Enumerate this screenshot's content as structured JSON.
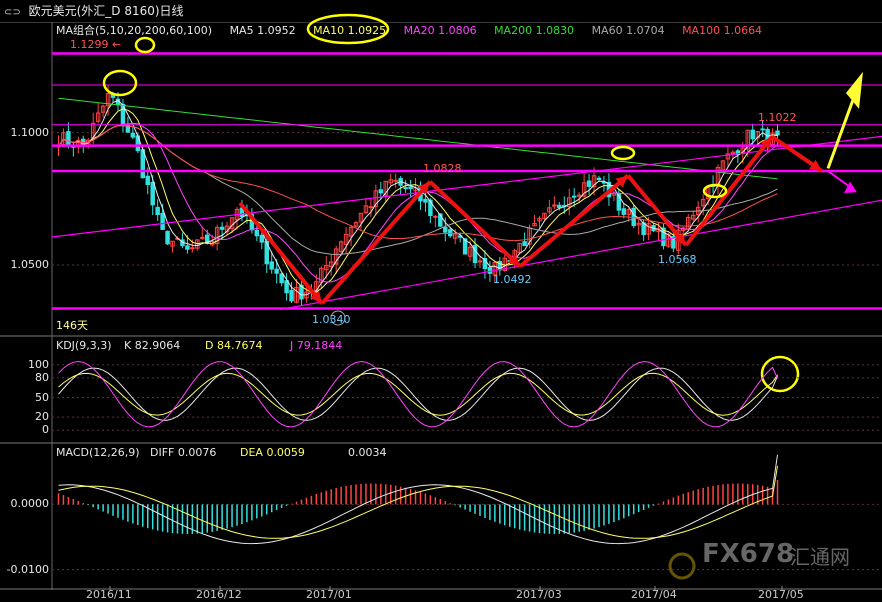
{
  "window": {
    "symbol_icon": "chart-toggle-icon",
    "title": "欧元美元(外汇_D 8160)日线"
  },
  "ma_header": {
    "group": "MA组合(5,10,20,200,60,100)",
    "ma5": "MA5 1.0952",
    "ma10": "MA10 1.0925",
    "ma20": "MA20 1.0806",
    "ma200": "MA200 1.0830",
    "ma60": "MA60 1.0704",
    "ma100": "MA100 1.0664"
  },
  "colors": {
    "ma5": "#e8e8e8",
    "ma10": "#ffff66",
    "ma20": "#ff44ff",
    "ma200": "#33dd33",
    "ma60": "#aaaaaa",
    "ma100": "#ff5050",
    "up": "#ff4444",
    "down": "#33e0e0",
    "trend": "#ff00ff",
    "arrow": "#ee1111",
    "highlight": "#ffff00"
  },
  "chart_data": [
    {
      "type": "candlestick",
      "title": "欧元美元(外汇_D 8160)日线",
      "x_labels": [
        "2016/11",
        "2016/12",
        "2017/01",
        "2017/03",
        "2017/04",
        "2017/05"
      ],
      "ytick_labels": [
        "1.1000",
        "1.0500"
      ],
      "ylim": [
        1.03,
        1.135
      ],
      "annotations": [
        {
          "label": "1.1299",
          "value": 1.1299
        },
        {
          "label": "1.0828",
          "value": 1.0828
        },
        {
          "label": "1.1022",
          "value": 1.1022
        },
        {
          "label": "1.0492",
          "value": 1.0492
        },
        {
          "label": "1.0568",
          "value": 1.0568
        },
        {
          "label": "1.0340",
          "value": 1.034
        }
      ],
      "period_label": "146天",
      "horizontal_levels": [
        1.1299,
        1.0951,
        1.0855,
        1.0336
      ],
      "price_path": [
        1.098,
        1.095,
        1.115,
        1.095,
        1.062,
        1.055,
        1.06,
        1.072,
        1.055,
        1.038,
        1.042,
        1.06,
        1.072,
        1.082,
        1.076,
        1.064,
        1.055,
        1.048,
        1.058,
        1.068,
        1.078,
        1.083,
        1.07,
        1.063,
        1.058,
        1.075,
        1.09,
        1.1,
        1.097
      ],
      "series": [
        {
          "name": "MA5",
          "value": 1.0952
        },
        {
          "name": "MA10",
          "value": 1.0925
        },
        {
          "name": "MA20",
          "value": 1.0806
        },
        {
          "name": "MA200",
          "value": 1.083
        },
        {
          "name": "MA60",
          "value": 1.0704
        },
        {
          "name": "MA100",
          "value": 1.0664
        }
      ]
    },
    {
      "type": "line",
      "title": "KDJ(9,3,3)",
      "ytick_labels": [
        "100",
        "80",
        "50",
        "20",
        "0"
      ],
      "ylim": [
        -15,
        115
      ],
      "series": [
        {
          "name": "K",
          "value": 82.9064
        },
        {
          "name": "D",
          "value": 84.7674
        },
        {
          "name": "J",
          "value": 79.1844
        }
      ]
    },
    {
      "type": "bar",
      "title": "MACD(12,26,9)",
      "ytick_labels": [
        "0.0000",
        "-0.0100"
      ],
      "ylim": [
        -0.0125,
        0.0065
      ],
      "series": [
        {
          "name": "DIFF",
          "value": 0.0076
        },
        {
          "name": "DEA",
          "value": 0.0059
        },
        {
          "name": "MACD",
          "value": 0.0034
        }
      ]
    }
  ],
  "panels": {
    "kdj": {
      "label": "KDJ(9,3,3)",
      "k": "K   82.9064",
      "d": "D   84.7674",
      "j": "J   79.1844"
    },
    "macd": {
      "label": "MACD(12,26,9)",
      "diff": "DIFF   0.0076",
      "dea": "DEA   0.0059",
      "macd": "0.0034"
    }
  },
  "watermark": {
    "text": "FX678",
    "cn": "汇通网"
  }
}
